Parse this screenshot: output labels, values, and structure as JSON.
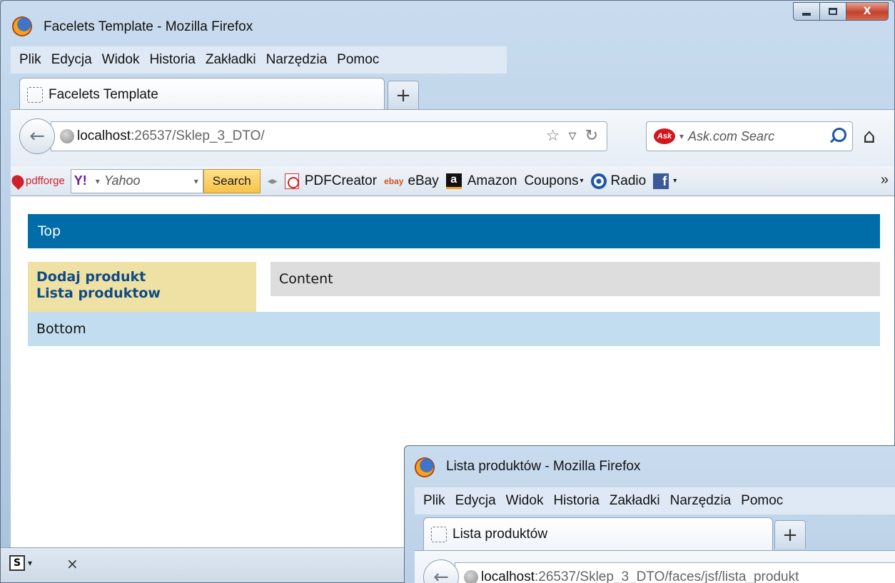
{
  "window": {
    "title": "Facelets Template - Mozilla Firefox",
    "menu": [
      "Plik",
      "Edycja",
      "Widok",
      "Historia",
      "Zakładki",
      "Narzędzia",
      "Pomoc"
    ],
    "tab_title": "Facelets Template",
    "newtab_label": "+",
    "url_host": "localhost",
    "url_path": ":26537/Sklep_3_DTO/",
    "search_placeholder": "Ask.com Searc",
    "search_engine_logo": "Ask"
  },
  "bookmarks": {
    "pdfforge": "pdfforge",
    "yahoo_logo": "Y!",
    "yahoo_placeholder": "Yahoo",
    "search_button": "Search",
    "items": [
      {
        "label": "PDFCreator",
        "icon": "pdf-icon"
      },
      {
        "label": "eBay",
        "icon": "ebay-icon"
      },
      {
        "label": "Amazon",
        "icon": "amazon-icon"
      },
      {
        "label": "Coupons",
        "icon": "coupons-icon"
      },
      {
        "label": "Radio",
        "icon": "radio-icon"
      }
    ],
    "more": "»"
  },
  "page": {
    "top": "Top",
    "nav": [
      "Dodaj produkt",
      "Lista produktow"
    ],
    "content": "Content",
    "bottom": "Bottom"
  },
  "addon_bar": {
    "s_label": "S",
    "close": "×"
  },
  "window2": {
    "title": "Lista produktów - Mozilla Firefox",
    "menu": [
      "Plik",
      "Edycja",
      "Widok",
      "Historia",
      "Zakładki",
      "Narzędzia",
      "Pomoc"
    ],
    "tab_title": "Lista produktów",
    "newtab_label": "+",
    "url_host": "localhost",
    "url_path": ":26537/Sklep_3_DTO/faces/jsf/lista_produkt"
  },
  "colors": {
    "top_bar": "#006ca8",
    "left_nav": "#efe0a3",
    "content": "#dddddd",
    "bottom": "#c1ddef",
    "link": "#0e4a86"
  }
}
